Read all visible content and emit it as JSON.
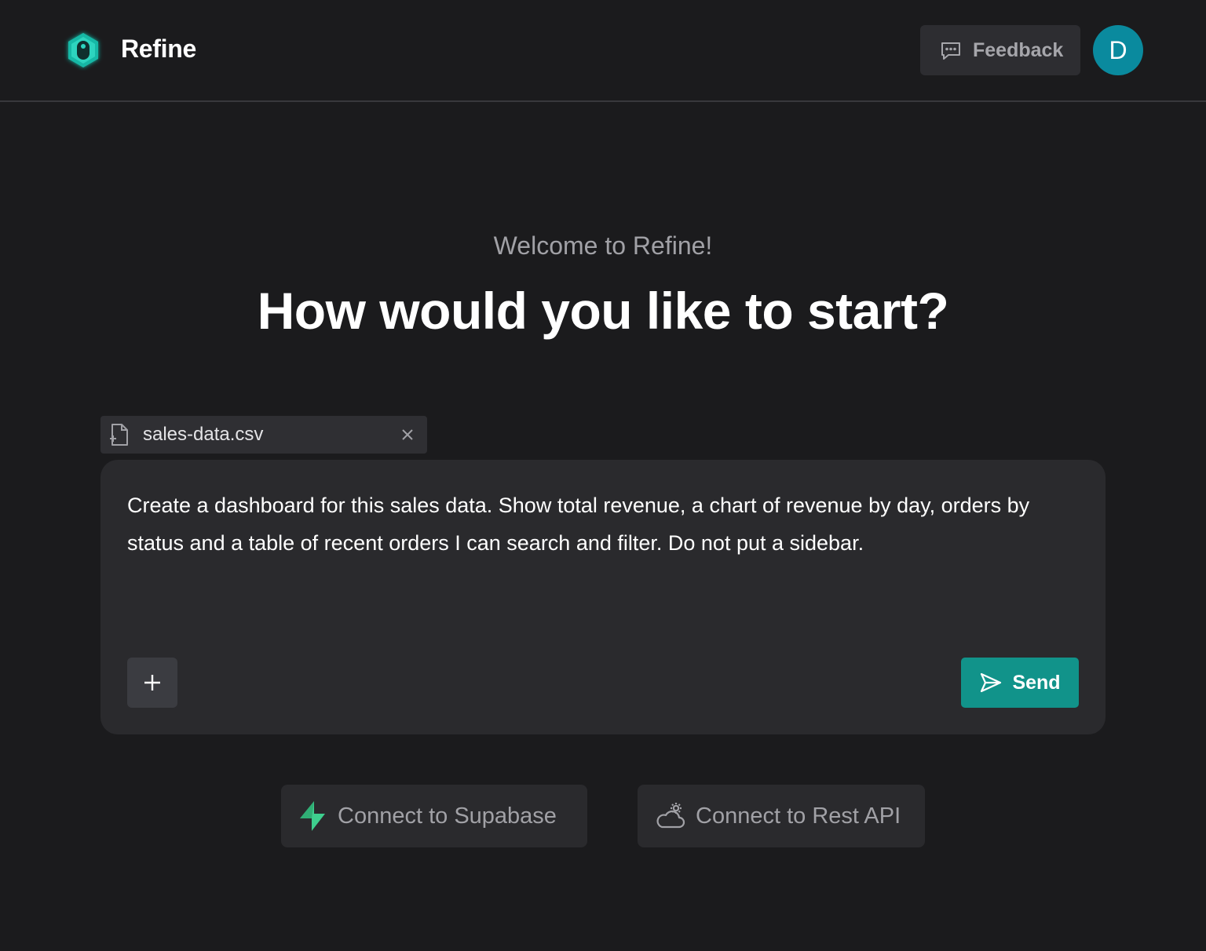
{
  "header": {
    "brand": "Refine",
    "feedback_label": "Feedback",
    "avatar_initial": "D",
    "colors": {
      "logo_accent": "#2dd4bf",
      "avatar_bg": "#0a8a9e"
    }
  },
  "hero": {
    "welcome": "Welcome to Refine!",
    "headline": "How would you like to start?"
  },
  "attachment": {
    "filename": "sales-data.csv",
    "icon": "file-plus-icon"
  },
  "prompt": {
    "text": "Create a dashboard for this sales data. Show total revenue, a chart of revenue by day, orders by status and a table of recent orders I can search and filter. Do not put a sidebar.",
    "send_label": "Send",
    "send_color": "#11938a"
  },
  "connect": {
    "supabase_label": "Connect to Supabase",
    "restapi_label": "Connect to Rest API",
    "supabase_color": "#3ecf8e"
  }
}
